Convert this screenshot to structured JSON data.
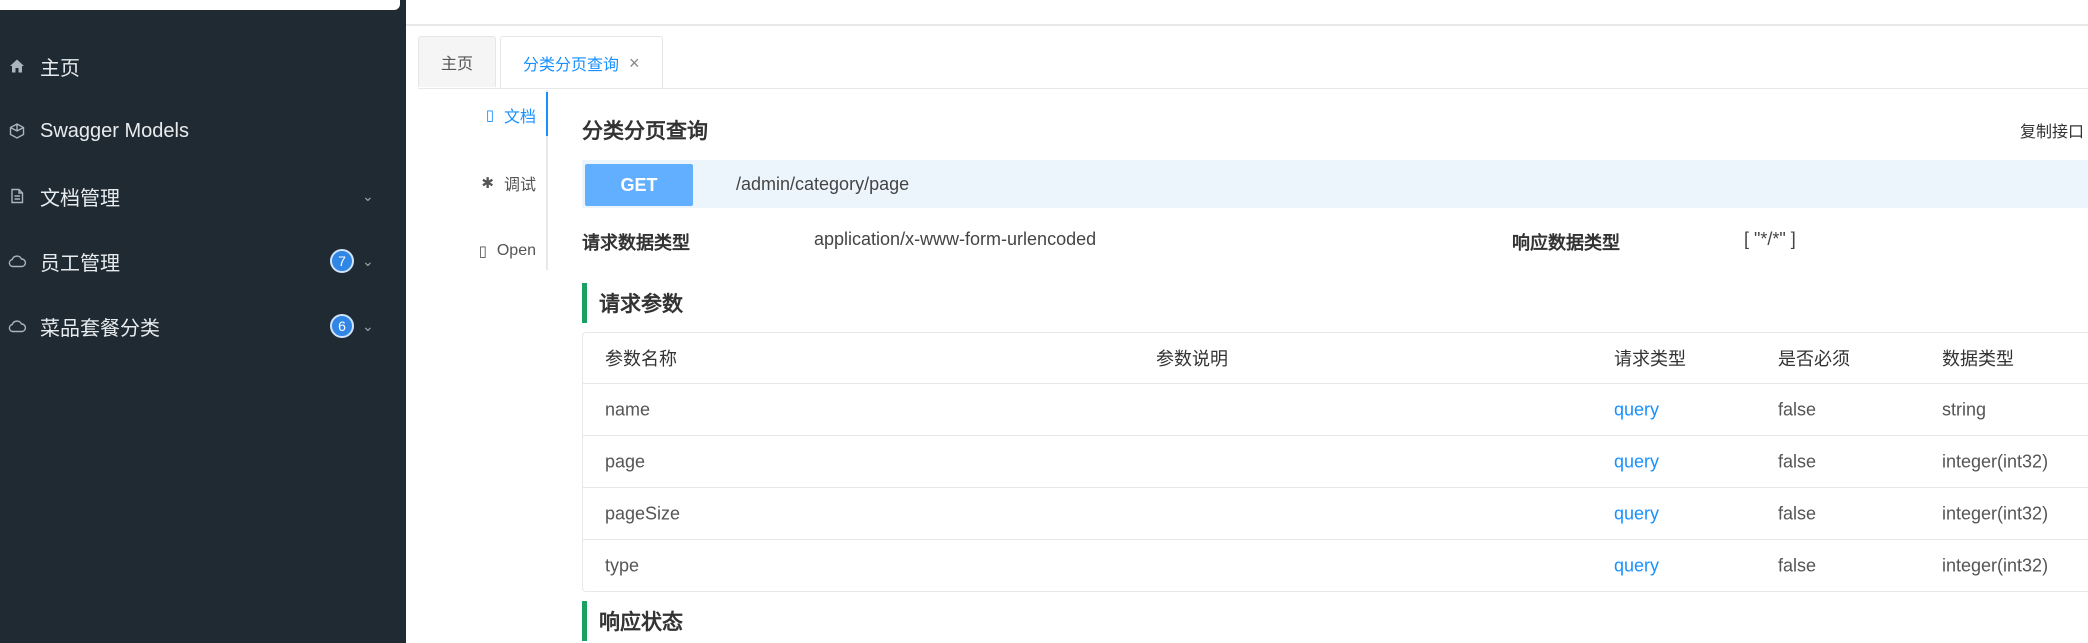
{
  "sidebar": {
    "items": [
      {
        "label": "主页",
        "icon": "home-icon"
      },
      {
        "label": "Swagger Models",
        "icon": "cube-icon"
      },
      {
        "label": "文档管理",
        "icon": "document-icon"
      },
      {
        "label": "员工管理",
        "icon": "cloud-icon",
        "badge": "7"
      },
      {
        "label": "菜品套餐分类",
        "icon": "cloud-icon",
        "badge": "6"
      }
    ]
  },
  "tabs": [
    {
      "label": "主页"
    },
    {
      "label": "分类分页查询",
      "close": "×"
    }
  ],
  "doc_tabs": [
    {
      "label": "文档",
      "icon": "document-icon"
    },
    {
      "label": "调试",
      "icon": "bug-icon"
    },
    {
      "label": "Open",
      "icon": "file-icon"
    }
  ],
  "api": {
    "title": "分类分页查询",
    "copy_label": "复制接口",
    "method": "GET",
    "path": "/admin/category/page",
    "request_type_label": "请求数据类型",
    "request_type_value": "application/x-www-form-urlencoded",
    "response_type_label": "响应数据类型",
    "response_type_value": "[ \"*/*\" ]"
  },
  "params_section": "请求参数",
  "params_table": {
    "headers": [
      "参数名称",
      "参数说明",
      "请求类型",
      "是否必须",
      "数据类型"
    ],
    "rows": [
      [
        "name",
        "",
        "query",
        "false",
        "string"
      ],
      [
        "page",
        "",
        "query",
        "false",
        "integer(int32)"
      ],
      [
        "pageSize",
        "",
        "query",
        "false",
        "integer(int32)"
      ],
      [
        "type",
        "",
        "query",
        "false",
        "integer(int32)"
      ]
    ]
  },
  "response_section": "响应状态",
  "colors": {
    "sidebar_bg": "#1f2a33",
    "accent": "#1890ff",
    "get_method": "#61affe",
    "section_bar": "#1aa061"
  }
}
